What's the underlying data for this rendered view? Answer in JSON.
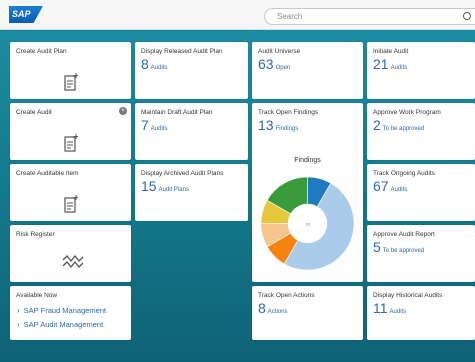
{
  "shell": {
    "logo": "SAP",
    "search_placeholder": "Search"
  },
  "tiles": {
    "create_audit_plan": {
      "title": "Create Audit Plan"
    },
    "create_audit": {
      "title": "Create Audit",
      "close": "×"
    },
    "create_auditable_item": {
      "title": "Create Auditable Item"
    },
    "risk_register": {
      "title": "Risk Register"
    },
    "available_now": {
      "title": "Available Now",
      "links": [
        "SAP Fraud Management",
        "SAP Audit Management"
      ]
    },
    "display_released_audit_plan": {
      "title": "Display Released Audit Plan",
      "value": "8",
      "unit": "Audits"
    },
    "maintain_draft_audit_plan": {
      "title": "Maintain Draft Audit Plan",
      "value": "7",
      "unit": "Audits"
    },
    "display_archived_audit_plans": {
      "title": "Display Archived Audit Plans",
      "value": "15",
      "unit": "Audit Plans"
    },
    "audit_universe": {
      "title": "Audit Universe",
      "value": "63",
      "unit": "Open"
    },
    "track_open_findings": {
      "title": "Track Open Findings",
      "value": "13",
      "unit": "Findings",
      "chart_title": "Findings",
      "center_label": "13"
    },
    "track_open_actions": {
      "title": "Track Open Actions",
      "value": "8",
      "unit": "Actions"
    },
    "initiate_audit": {
      "title": "Initiate Audit",
      "value": "21",
      "unit": "Audits"
    },
    "approve_work_program": {
      "title": "Approve Work Program",
      "value": "2",
      "unit": "To be approved"
    },
    "track_ongoing_audits": {
      "title": "Track Ongoing Audits",
      "value": "67",
      "unit": "Audits"
    },
    "approve_audit_report": {
      "title": "Approve Audit Report",
      "value": "5",
      "unit": "To be approved"
    },
    "display_historical_audits": {
      "title": "Display Historical Audits",
      "value": "11",
      "unit": "Audits"
    }
  },
  "chart_data": {
    "type": "pie",
    "title": "Findings",
    "series": [
      {
        "value": 1,
        "color": "#1f7ac0"
      },
      {
        "value": 6,
        "color": "#aacbea"
      },
      {
        "value": 1,
        "color": "#f7830f"
      },
      {
        "value": 1,
        "color": "#f8c58e"
      },
      {
        "value": 1,
        "color": "#e6c83c"
      },
      {
        "value": 2,
        "color": "#3a9b3a"
      }
    ]
  },
  "colors": {
    "background": "#1a8598",
    "kpi_blue": "#2b6aa8"
  }
}
